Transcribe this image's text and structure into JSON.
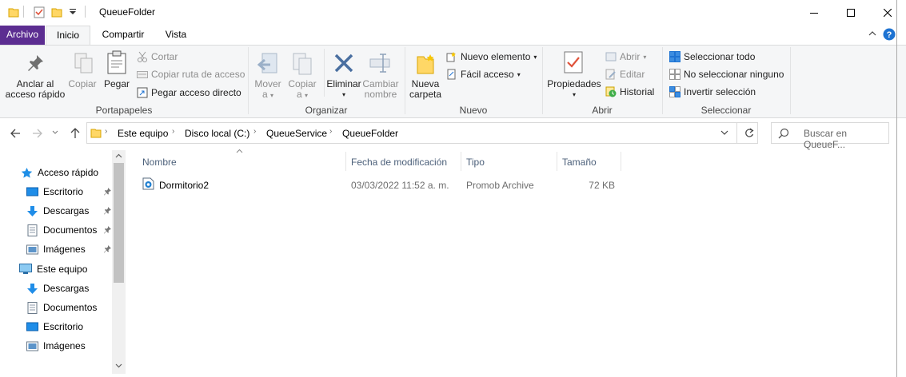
{
  "window": {
    "title": "QueueFolder",
    "minimize_icon": "minimize-icon",
    "maximize_icon": "maximize-icon",
    "close_icon": "close-icon"
  },
  "tabs": [
    {
      "label": "Archivo"
    },
    {
      "label": "Inicio"
    },
    {
      "label": "Compartir"
    },
    {
      "label": "Vista"
    }
  ],
  "ribbon": {
    "portapapeles": {
      "group_label": "Portapapeles",
      "anclar": "Anclar al\nacceso rápido",
      "copiar": "Copiar",
      "pegar": "Pegar",
      "cortar": "Cortar",
      "copiar_ruta": "Copiar ruta de acceso",
      "pegar_acceso": "Pegar acceso directo"
    },
    "organizar": {
      "group_label": "Organizar",
      "mover": "Mover",
      "mover_sub": "a",
      "copiar": "Copiar",
      "copiar_sub": "a",
      "eliminar": "Eliminar",
      "cambiar": "Cambiar",
      "cambiar_sub": "nombre"
    },
    "nuevo": {
      "group_label": "Nuevo",
      "nueva": "Nueva",
      "nueva_sub": "carpeta",
      "nuevo_elemento": "Nuevo elemento",
      "facil_acceso": "Fácil acceso"
    },
    "abrir": {
      "group_label": "Abrir",
      "propiedades": "Propiedades",
      "abrir": "Abrir",
      "editar": "Editar",
      "historial": "Historial"
    },
    "seleccionar": {
      "group_label": "Seleccionar",
      "todo": "Seleccionar todo",
      "ninguno": "No seleccionar ninguno",
      "invertir": "Invertir selección"
    }
  },
  "address": {
    "crumbs": [
      "Este equipo",
      "Disco local (C:)",
      "QueueService",
      "QueueFolder"
    ],
    "search_placeholder": "Buscar en QueueF..."
  },
  "nav": {
    "quick_access": "Acceso rápido",
    "quick_items": [
      "Escritorio",
      "Descargas",
      "Documentos",
      "Imágenes"
    ],
    "this_pc": "Este equipo",
    "pc_items": [
      "Descargas",
      "Documentos",
      "Escritorio",
      "Imágenes"
    ]
  },
  "columns": {
    "name": "Nombre",
    "date": "Fecha de modificación",
    "type": "Tipo",
    "size": "Tamaño"
  },
  "files": [
    {
      "name": "Dormitorio2",
      "date": "03/03/2022 11:52 a. m.",
      "type": "Promob Archive",
      "size": "72 KB"
    }
  ],
  "colors": {
    "archivo_tab": "#5c2d91",
    "accent_blue": "#0078d7",
    "folder_yellow": "#ffd766"
  }
}
